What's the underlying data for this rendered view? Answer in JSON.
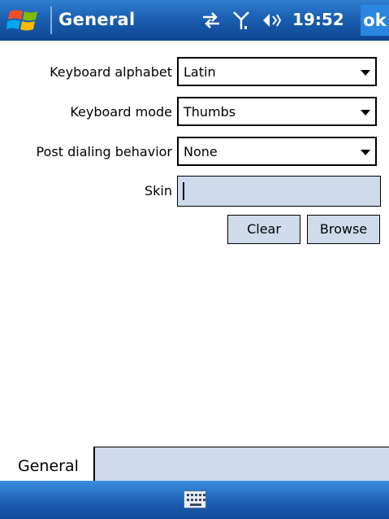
{
  "titlebar": {
    "title": "General",
    "time": "19:52",
    "ok_label": "ok",
    "icons": [
      "windows-start-icon",
      "connectivity-icon",
      "signal-icon",
      "volume-icon"
    ]
  },
  "form": {
    "keyboard_alphabet": {
      "label": "Keyboard alphabet",
      "value": "Latin"
    },
    "keyboard_mode": {
      "label": "Keyboard mode",
      "value": "Thumbs"
    },
    "post_dialing": {
      "label": "Post dialing behavior",
      "value": "None"
    },
    "skin": {
      "label": "Skin",
      "value": ""
    },
    "clear_label": "Clear",
    "browse_label": "Browse"
  },
  "tabs": {
    "active": "General"
  },
  "menubar": {
    "icons": [
      "keyboard-icon"
    ]
  },
  "colors": {
    "titlebar": "#1b5fb1",
    "field_bg": "#cfdbeb",
    "ok_bg": "#2a86de"
  }
}
